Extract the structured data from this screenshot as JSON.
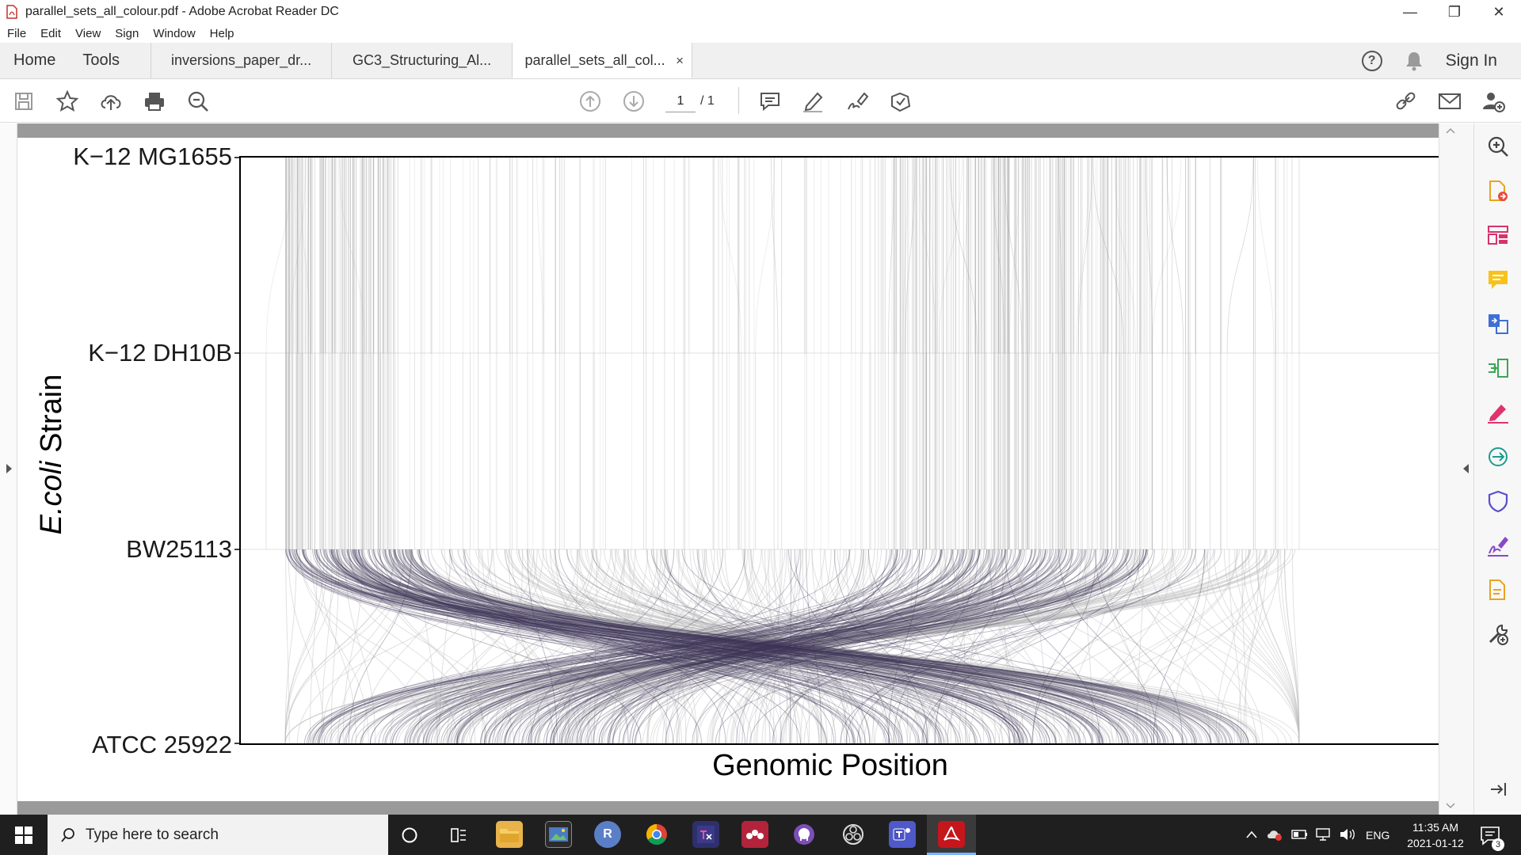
{
  "window": {
    "title": "parallel_sets_all_colour.pdf - Adobe Acrobat Reader DC",
    "controls": {
      "minimize": "—",
      "restore": "❐",
      "close": "✕"
    }
  },
  "menu": [
    "File",
    "Edit",
    "View",
    "Sign",
    "Window",
    "Help"
  ],
  "tabs": {
    "home": "Home",
    "tools": "Tools",
    "documents": [
      {
        "label": "inversions_paper_dr...",
        "active": false
      },
      {
        "label": "GC3_Structuring_Al...",
        "active": false
      },
      {
        "label": "parallel_sets_all_col...",
        "active": true,
        "close": "×"
      }
    ],
    "help": "?",
    "sign_in": "Sign In"
  },
  "toolbar": {
    "page_current": "1",
    "page_total": "/ 1",
    "icons": [
      "save-icon",
      "bookmark-star-icon",
      "upload-icon",
      "print-icon",
      "zoom-out-icon",
      "prev-page-icon",
      "next-page-icon",
      "comment-icon",
      "highlight-icon",
      "sign-icon",
      "stamp-icon",
      "share-link-icon",
      "mail-icon",
      "add-user-icon"
    ]
  },
  "chart_data": {
    "type": "parallel_sets",
    "ylabel_italic": "E.coli",
    "ylabel_rest": " Strain",
    "xlabel": "Genomic Position",
    "strains": [
      "K−12 MG1655",
      "K−12 DH10B",
      "BW25113",
      "ATCC 25922"
    ],
    "grid": true,
    "colors": {
      "light_ribbon": "#bdbdbd",
      "dark_ribbon": "#3c3556",
      "axis": "#000000"
    }
  },
  "right_panel": {
    "icons": [
      "zoom-in-icon",
      "export-pdf-icon",
      "organize-pages-icon",
      "comment-icon",
      "convert-icon",
      "compress-icon",
      "fill-sign-icon",
      "send-for-review-icon",
      "protect-icon",
      "signature-icon",
      "create-pdf-icon",
      "tools-more-icon"
    ]
  },
  "taskbar": {
    "search_placeholder": "Type here to search",
    "apps": [
      "cortana-icon",
      "task-view-icon",
      "file-explorer-icon",
      "photos-icon",
      "r-icon",
      "chrome-icon",
      "texstudio-icon",
      "mendeley-icon",
      "github-icon",
      "obs-icon",
      "teams-icon",
      "acrobat-icon"
    ],
    "r_label": "R",
    "language": "ENG",
    "time": "11:35 AM",
    "date": "2021-01-12",
    "notification_count": "3"
  }
}
